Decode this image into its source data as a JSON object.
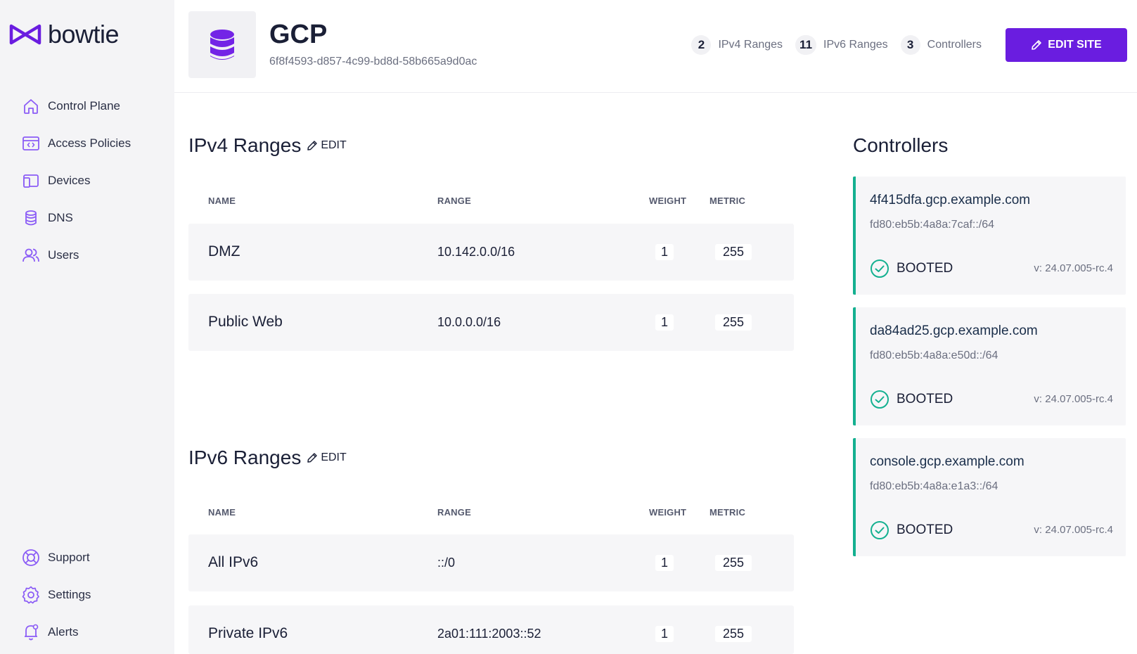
{
  "brand": {
    "name": "bowtie",
    "accent": "#6a1de0",
    "success": "#14b090"
  },
  "sidebar": {
    "top_items": [
      {
        "label": "Control Plane",
        "icon": "home-icon"
      },
      {
        "label": "Access Policies",
        "icon": "policy-icon"
      },
      {
        "label": "Devices",
        "icon": "devices-icon"
      },
      {
        "label": "DNS",
        "icon": "database-icon"
      },
      {
        "label": "Users",
        "icon": "users-icon"
      }
    ],
    "bottom_items": [
      {
        "label": "Support",
        "icon": "lifebuoy-icon"
      },
      {
        "label": "Settings",
        "icon": "gear-icon"
      },
      {
        "label": "Alerts",
        "icon": "bell-icon"
      }
    ]
  },
  "header": {
    "title": "GCP",
    "site_id": "6f8f4593-d857-4c99-bd8d-58b665a9d0ac",
    "stats": [
      {
        "count": "2",
        "label": "IPv4 Ranges"
      },
      {
        "count": "11",
        "label": "IPv6 Ranges"
      },
      {
        "count": "3",
        "label": "Controllers"
      }
    ],
    "edit_label": "EDIT SITE"
  },
  "columns": {
    "name": "NAME",
    "range": "RANGE",
    "weight": "WEIGHT",
    "metric": "METRIC"
  },
  "ipv4": {
    "title": "IPv4 Ranges",
    "edit_label": "EDIT",
    "rows": [
      {
        "name": "DMZ",
        "range": "10.142.0.0/16",
        "weight": "1",
        "metric": "255"
      },
      {
        "name": "Public Web",
        "range": "10.0.0.0/16",
        "weight": "1",
        "metric": "255"
      }
    ]
  },
  "ipv6": {
    "title": "IPv6 Ranges",
    "edit_label": "EDIT",
    "rows": [
      {
        "name": "All IPv6",
        "range": "::/0",
        "weight": "1",
        "metric": "255"
      },
      {
        "name": "Private IPv6",
        "range": "2a01:111:2003::52",
        "weight": "1",
        "metric": "255"
      }
    ]
  },
  "controllers": {
    "title": "Controllers",
    "items": [
      {
        "name": "4f415dfa.gcp.example.com",
        "address": "fd80:eb5b:4a8a:7caf::/64",
        "status": "BOOTED",
        "version": "v: 24.07.005-rc.4"
      },
      {
        "name": "da84ad25.gcp.example.com",
        "address": "fd80:eb5b:4a8a:e50d::/64",
        "status": "BOOTED",
        "version": "v: 24.07.005-rc.4"
      },
      {
        "name": "console.gcp.example.com",
        "address": "fd80:eb5b:4a8a:e1a3::/64",
        "status": "BOOTED",
        "version": "v: 24.07.005-rc.4"
      }
    ]
  }
}
